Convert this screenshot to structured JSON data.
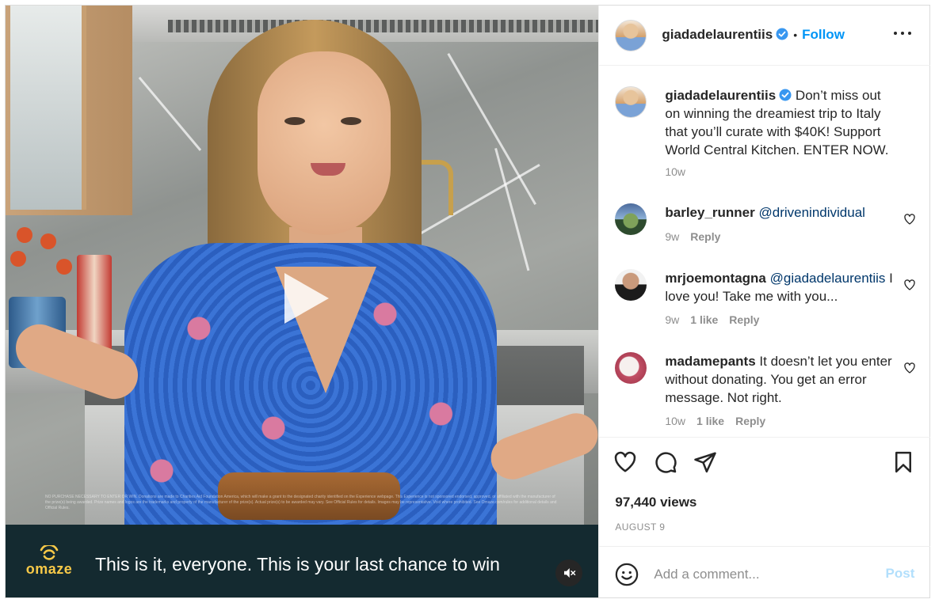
{
  "video": {
    "caption": "This is it, everyone. This is your last chance to win",
    "brand": "omaze",
    "disclaimer": "NO PURCHASE NECESSARY TO ENTER OR WIN. Donations are made to Charities Aid Foundation America, which will make a grant to the designated charity identified on the Experience webpage. This Experience is not sponsored endorsed, approved, or affiliated with the manufacturer of the prize(s) being awarded. Prize names and logos are the trademarks and property of the manufacturer of the prize(s). Actual prize(s) to be awarded may vary. See Official Rules for details. Images may be representative. Void where prohibited. See Omaze.com/rules for additional details and Official Rules.",
    "controls": {
      "play_icon": "play-icon",
      "mute_icon": "muted-speaker-icon"
    }
  },
  "header": {
    "username": "giadadelaurentiis",
    "separator": "•",
    "follow_label": "Follow",
    "more_icon": "more-options-icon"
  },
  "post": {
    "username": "giadadelaurentiis",
    "text": "Don’t miss out on winning the dreamiest trip to Italy that you’ll curate with $40K! Support World Central Kitchen. ENTER NOW.",
    "time": "10w"
  },
  "comments": [
    {
      "username": "barley_runner",
      "text": "@drivenindividual",
      "time": "9w",
      "likes": "",
      "reply": "Reply"
    },
    {
      "username": "mrjoemontagna",
      "mention": "@giadadelaurentiis",
      "text": "I love you! Take me with you...",
      "time": "9w",
      "likes": "1 like",
      "reply": "Reply"
    },
    {
      "username": "madamepants",
      "text": "It doesn’t let you enter without donating. You get an error message. Not right.",
      "time": "10w",
      "likes": "1 like",
      "reply": "Reply"
    }
  ],
  "stats": {
    "views": "97,440 views",
    "date": "AUGUST 9"
  },
  "composer": {
    "placeholder": "Add a comment...",
    "post_label": "Post"
  },
  "colors": {
    "accent": "#0095f6",
    "caption_bar": "#142a30",
    "brand_yellow": "#f7c948",
    "post_disabled": "#b2dffc"
  }
}
